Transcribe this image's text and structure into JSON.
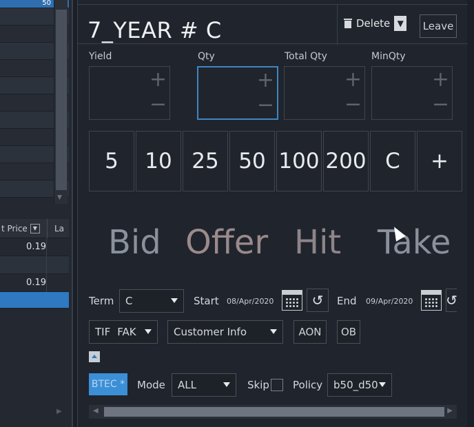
{
  "left_panel": {
    "top_row_value": "50",
    "grid_header": {
      "col1": "t Price",
      "col2": "La"
    },
    "rows": [
      {
        "price": "0.19"
      },
      {
        "price": ""
      },
      {
        "price": "0.19"
      }
    ]
  },
  "ticket": {
    "title": "7_YEAR # C",
    "delete_label": "Delete",
    "leave_label": "Leave",
    "fields": [
      {
        "label": "Yield",
        "value": ""
      },
      {
        "label": "Qty",
        "value": ""
      },
      {
        "label": "Total Qty",
        "value": ""
      },
      {
        "label": "MinQty",
        "value": ""
      }
    ],
    "qty_buttons": [
      "5",
      "10",
      "25",
      "50",
      "100",
      "200",
      "C",
      "+"
    ],
    "sides": {
      "bid": "Bid",
      "offer": "Offer",
      "hit": "Hit",
      "take": "Take"
    },
    "term_label": "Term",
    "term_value": "C",
    "start_label": "Start",
    "start_date": "08/Apr/2020",
    "end_label": "End",
    "end_date": "09/Apr/2020",
    "tif_label": "TIF",
    "tif_value": "FAK",
    "customer_info": "Customer Info",
    "aon_label": "AON",
    "ob_label": "OB",
    "btec_label": "BTEC *",
    "mode_label": "Mode",
    "mode_value": "ALL",
    "skip_label": "Skip",
    "policy_label": "Policy",
    "policy_value": "b50_d50"
  },
  "colors": {
    "background": "#20242c",
    "accent_blue": "#3b8fd6",
    "focus_border": "#3e86c4",
    "selected_row": "#2e79c0"
  }
}
